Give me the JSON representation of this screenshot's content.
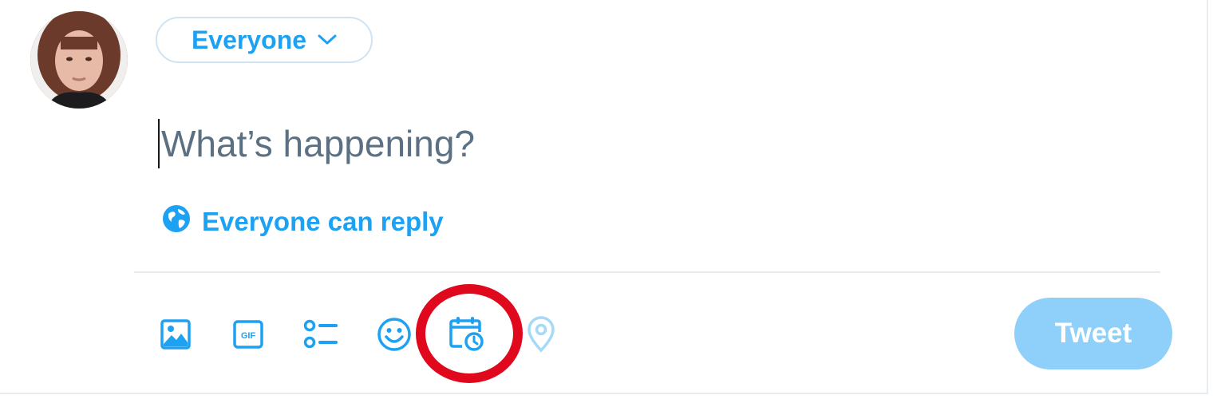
{
  "composer": {
    "audience_label": "Everyone",
    "placeholder": "What’s happening?",
    "reply_setting_label": "Everyone can reply",
    "tweet_button_label": "Tweet"
  },
  "toolbar": {
    "icons": [
      {
        "name": "media-icon"
      },
      {
        "name": "gif-icon",
        "text": "GIF"
      },
      {
        "name": "poll-icon"
      },
      {
        "name": "emoji-icon"
      },
      {
        "name": "schedule-icon",
        "highlighted": true
      },
      {
        "name": "location-icon",
        "disabled": true
      }
    ]
  },
  "colors": {
    "accent": "#1da1f2",
    "tweet_button_disabled": "#8ed0f9",
    "highlight": "#e0081c",
    "placeholder_text": "#5b7083",
    "divider": "#e6ecf0"
  }
}
